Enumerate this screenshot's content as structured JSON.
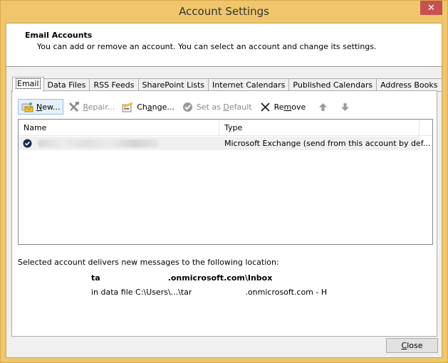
{
  "window": {
    "title": "Account Settings",
    "close_glyph": "✕"
  },
  "header": {
    "title": "Email Accounts",
    "description": "You can add or remove an account. You can select an account and change its settings."
  },
  "tabs": [
    {
      "label": "Email",
      "active": true
    },
    {
      "label": "Data Files",
      "active": false
    },
    {
      "label": "RSS Feeds",
      "active": false
    },
    {
      "label": "SharePoint Lists",
      "active": false
    },
    {
      "label": "Internet Calendars",
      "active": false
    },
    {
      "label": "Published Calendars",
      "active": false
    },
    {
      "label": "Address Books",
      "active": false
    }
  ],
  "toolbar": {
    "new": {
      "pre": "",
      "accel": "N",
      "post": "ew...",
      "icon": "new-account-icon",
      "enabled": true
    },
    "repair": {
      "pre": "",
      "accel": "R",
      "post": "epair...",
      "icon": "repair-tools-icon",
      "enabled": false
    },
    "change": {
      "pre": "Ch",
      "accel": "a",
      "post": "nge...",
      "icon": "change-account-icon",
      "enabled": true
    },
    "set_default": {
      "pre": "Set as ",
      "accel": "D",
      "post": "efault",
      "icon": "checkmark-circle-icon",
      "enabled": false
    },
    "remove": {
      "pre": "Re",
      "accel": "m",
      "post": "ove",
      "icon": "x-icon",
      "enabled": true
    },
    "move_up": {
      "icon": "arrow-up-icon",
      "enabled": false
    },
    "move_down": {
      "icon": "arrow-down-icon",
      "enabled": false
    }
  },
  "accounts": {
    "columns": [
      "Name",
      "Type"
    ],
    "rows": [
      {
        "name": "[redacted]",
        "type": "Microsoft Exchange (send from this account by def...",
        "default": true
      }
    ]
  },
  "delivery": {
    "label": "Selected account delivers new messages to the following location:",
    "location_prefix": "ta",
    "location_suffix": ".onmicrosoft.com\\Inbox",
    "file_prefix": "in data file C:\\Users\\...\\tar",
    "file_suffix": ".onmicrosoft.com - H"
  },
  "footer": {
    "close": {
      "pre": "",
      "accel": "C",
      "post": "lose"
    }
  },
  "colors": {
    "frame": "#efc66b",
    "close_red": "#c75050",
    "hover_blue": "#e5f1fb",
    "hover_border": "#8ec1ea"
  }
}
